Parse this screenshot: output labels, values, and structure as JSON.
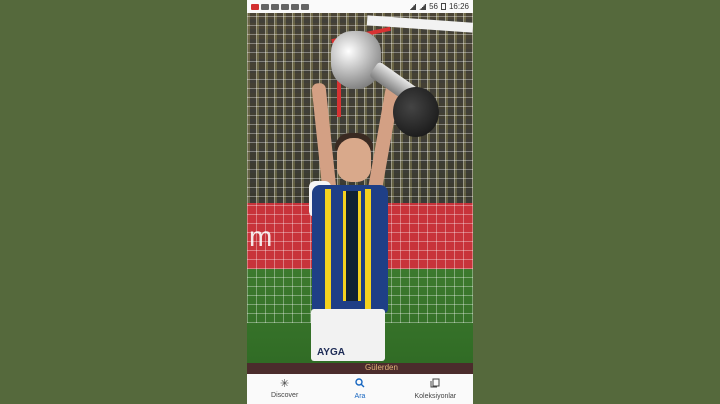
{
  "status_bar": {
    "network": "56",
    "time": "16:26"
  },
  "photo": {
    "board_text": "m",
    "sponsor_text": "AYGA",
    "banner_text": "Gülerden"
  },
  "nav": {
    "items": [
      {
        "label": "Discover",
        "icon": "sparkle-icon",
        "active": false
      },
      {
        "label": "Ara",
        "icon": "search-icon",
        "active": true
      },
      {
        "label": "Koleksiyonlar",
        "icon": "collections-icon",
        "active": false
      }
    ]
  },
  "colors": {
    "background": "#55693c",
    "active_nav": "#1565c0"
  }
}
